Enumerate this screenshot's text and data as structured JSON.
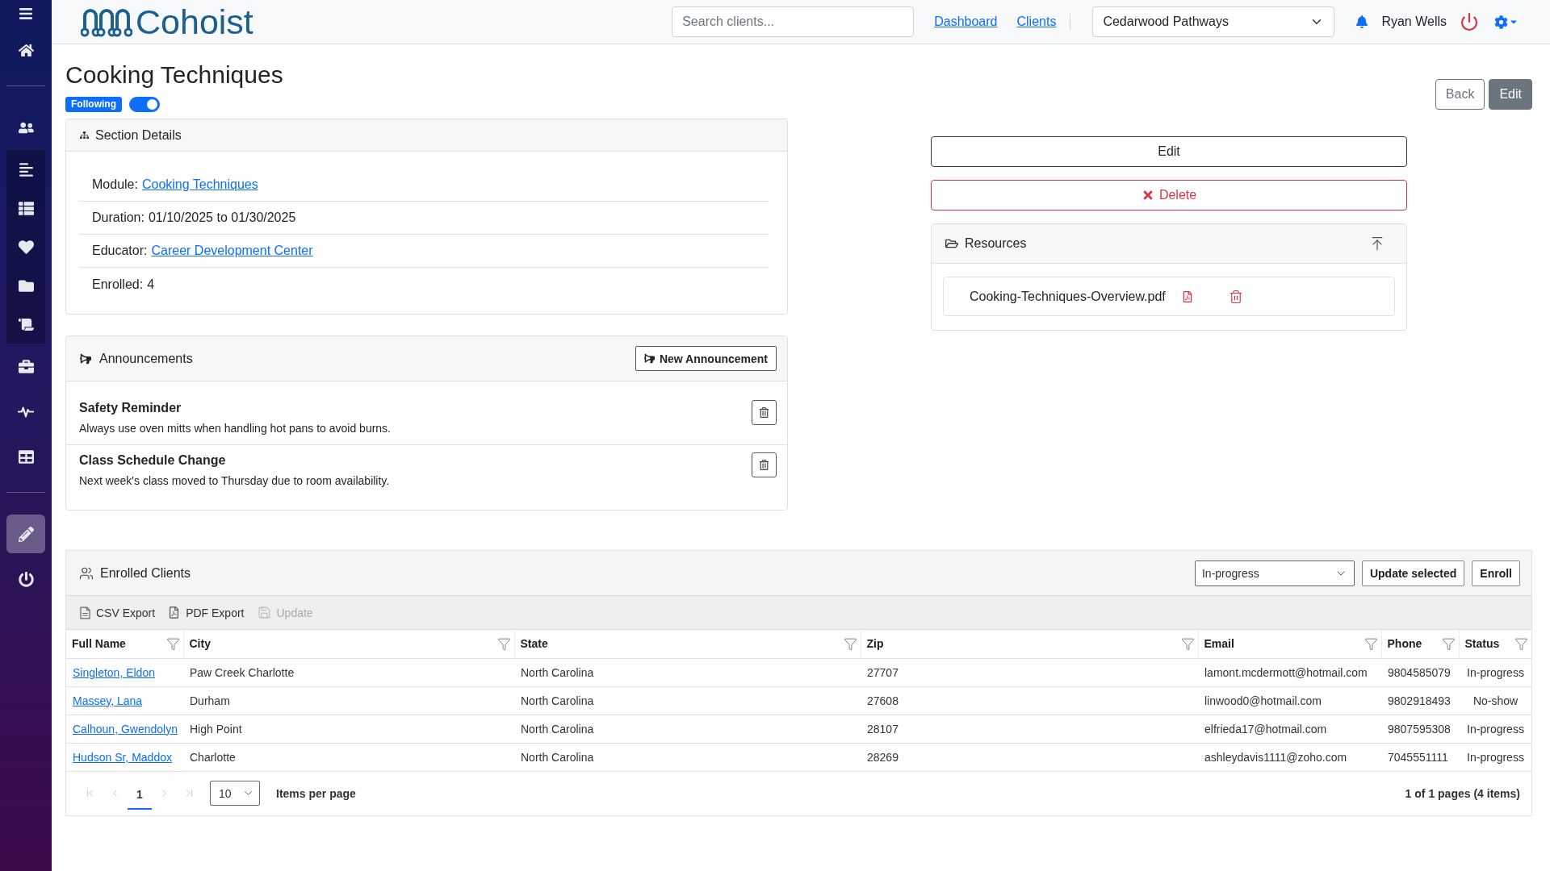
{
  "sidebar": {
    "groups": [
      {
        "items": [
          {
            "selected": false,
            "highlighted": false
          }
        ]
      },
      {
        "items": [
          {
            "selected": false,
            "highlighted": false
          },
          {
            "selected": false,
            "highlighted": true
          },
          {
            "selected": false,
            "highlighted": true
          },
          {
            "selected": false,
            "highlighted": true
          },
          {
            "selected": false,
            "highlighted": true
          },
          {
            "selected": false,
            "highlighted": true
          },
          {
            "selected": false,
            "highlighted": false
          },
          {
            "selected": false,
            "highlighted": false
          },
          {
            "selected": false,
            "highlighted": false
          }
        ]
      },
      {
        "items": [
          {
            "selected": true,
            "highlighted": false
          },
          {
            "selected": false,
            "highlighted": false
          }
        ]
      }
    ]
  },
  "header": {
    "brand": "Cohoist",
    "search": {
      "placeholder": "Search clients..."
    },
    "links": [
      "Dashboard",
      "Clients"
    ],
    "organization": "Cedarwood Pathways",
    "user": "Ryan Wells"
  },
  "page": {
    "title": "Cooking Techniques",
    "follow": {
      "badge": "Following",
      "on": true
    },
    "buttons": [
      {
        "label": "Back",
        "kind": "outline"
      },
      {
        "label": "Edit",
        "kind": "filled"
      }
    ]
  },
  "section_details": {
    "title": "Section Details",
    "rows": [
      {
        "label": "Module:",
        "value": "Cooking Techniques",
        "kind": "link"
      },
      {
        "label": "Duration:",
        "value": "01/10/2025 to 01/30/2025",
        "kind": "text"
      },
      {
        "label": "Educator:",
        "value": "Career Development Center",
        "kind": "link"
      },
      {
        "label": "Enrolled:",
        "value": "4",
        "kind": "text"
      }
    ]
  },
  "announcements": {
    "title": "Announcements",
    "new_button": "New Announcement",
    "items": [
      {
        "title": "Safety Reminder",
        "body": "Always use oven mitts when handling hot pans to avoid burns."
      },
      {
        "title": "Class Schedule Change",
        "body": "Next week's class moved to Thursday due to room availability."
      }
    ]
  },
  "actions": [
    {
      "label": "Edit",
      "kind": "outline"
    },
    {
      "label": "Delete",
      "kind": "danger"
    }
  ],
  "resources": {
    "title": "Resources",
    "files": [
      {
        "name": "Cooking-Techniques-Overview.pdf"
      }
    ]
  },
  "enrolled_clients": {
    "title": "Enrolled Clients",
    "status_select": {
      "value": "In-progress"
    },
    "buttons": [
      "Update selected",
      "Enroll"
    ],
    "toolbar": [
      {
        "label": "CSV Export",
        "disabled": false
      },
      {
        "label": "PDF Export",
        "disabled": false
      },
      {
        "label": "Update",
        "disabled": true
      }
    ],
    "table": {
      "columns": [
        "Full Name",
        "City",
        "State",
        "Zip",
        "Email",
        "Phone",
        "Status"
      ],
      "rows": [
        {
          "cells": [
            "Singleton, Eldon",
            "Paw Creek Charlotte",
            "North Carolina",
            "27707",
            "lamont.mcdermott@hotmail.com",
            "9804585079",
            "In-progress"
          ]
        },
        {
          "cells": [
            "Massey, Lana",
            "Durham",
            "North Carolina",
            "27608",
            "linwood0@hotmail.com",
            "9802918493",
            "No-show"
          ]
        },
        {
          "cells": [
            "Calhoun, Gwendolyn",
            "High Point",
            "North Carolina",
            "28107",
            "elfrieda17@hotmail.com",
            "9807595308",
            "In-progress"
          ]
        },
        {
          "cells": [
            "Hudson Sr, Maddox",
            "Charlotte",
            "North Carolina",
            "28269",
            "ashleydavis1111@zoho.com",
            "7045551111",
            "In-progress"
          ]
        }
      ]
    },
    "pager": {
      "nav": [
        {
          "disabled": true
        },
        {
          "disabled": true
        },
        {
          "disabled": true
        },
        {
          "disabled": true
        }
      ],
      "pages": [
        {
          "label": "1",
          "selected": true
        }
      ],
      "page_size": "10",
      "page_size_label": "Items per page",
      "summary": "1 of 1 pages (4 items)"
    }
  }
}
